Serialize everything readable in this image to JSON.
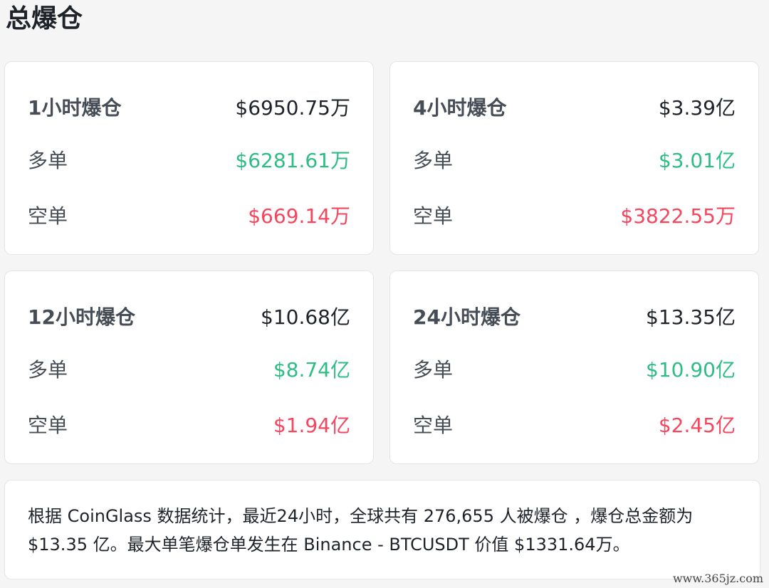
{
  "page_title": "总爆仓",
  "colors": {
    "long": "#2ebd85",
    "short": "#f6465d",
    "text": "#1e2329",
    "card_border": "#e3e5e8"
  },
  "cards": [
    {
      "label": "1小时爆仓",
      "total": "$6950.75万",
      "long_label": "多单",
      "long_value": "$6281.61万",
      "short_label": "空单",
      "short_value": "$669.14万"
    },
    {
      "label": "4小时爆仓",
      "total": "$3.39亿",
      "long_label": "多单",
      "long_value": "$3.01亿",
      "short_label": "空单",
      "short_value": "$3822.55万"
    },
    {
      "label": "12小时爆仓",
      "total": "$10.68亿",
      "long_label": "多单",
      "long_value": "$8.74亿",
      "short_label": "空单",
      "short_value": "$1.94亿"
    },
    {
      "label": "24小时爆仓",
      "total": "$13.35亿",
      "long_label": "多单",
      "long_value": "$10.90亿",
      "short_label": "空单",
      "short_value": "$2.45亿"
    }
  ],
  "summary": "根据 CoinGlass 数据统计，最近24小时，全球共有 276,655 人被爆仓 ，爆仓总金额为 $13.35 亿。最大单笔爆仓单发生在 Binance - BTCUSDT 价值 $1331.64万。",
  "watermark": "www.365jz.com"
}
